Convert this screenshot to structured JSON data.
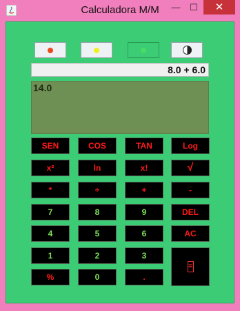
{
  "window": {
    "title": "Calculadora M/M",
    "minimize_glyph": "—",
    "maximize_glyph": "☐",
    "close_glyph": "✕"
  },
  "theme_buttons": [
    {
      "name": "theme-red-button",
      "dot_color": "#e84a1e"
    },
    {
      "name": "theme-yellow-button",
      "dot_color": "#f0f020"
    },
    {
      "name": "theme-green-button",
      "dot_color": "#3dcc76"
    },
    {
      "name": "theme-contrast-button",
      "icon": "contrast-icon"
    }
  ],
  "display": {
    "expression": "8.0 + 6.0",
    "result": "14.0"
  },
  "keys": {
    "sen": "SEN",
    "cos": "COS",
    "tan": "TAN",
    "log": "Log",
    "square": "x²",
    "ln": "ln",
    "factorial": "x!",
    "sqrt": "√",
    "multiply": "*",
    "divide": "÷",
    "add": "+",
    "subtract": "-",
    "seven": "7",
    "eight": "8",
    "nine": "9",
    "del": "DEL",
    "four": "4",
    "five": "5",
    "six": "6",
    "ac": "AC",
    "one": "1",
    "two": "2",
    "three": "3",
    "equals": "=",
    "percent": "%",
    "zero": "0",
    "dot": "."
  },
  "colors": {
    "background": "#3dcc76",
    "titlebar": "#f27fbd",
    "key_bg": "#000000",
    "key_red": "#ff1a1a",
    "key_green": "#7ee05a",
    "result_bg": "#6f9054"
  }
}
